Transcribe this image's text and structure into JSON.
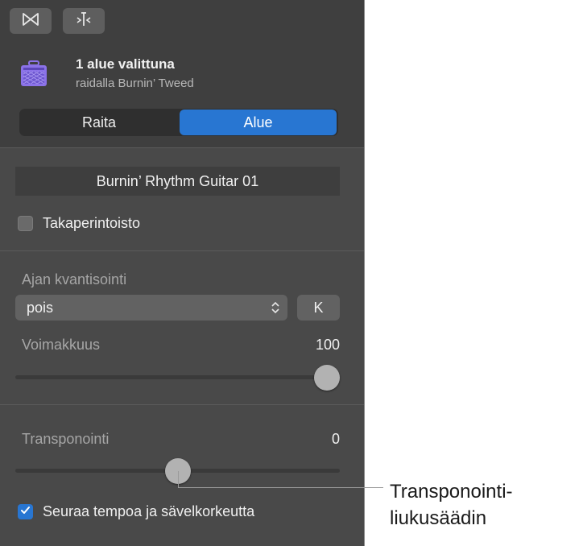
{
  "toolbar": {
    "icons": [
      "bowtie-icon",
      "split-icon"
    ]
  },
  "header": {
    "title": "1 alue valittuna",
    "subtitle": "raidalla Burnin’ Tweed",
    "icon": "guitar-amp-icon",
    "amp_color": "#8b72e8"
  },
  "segmented": {
    "raita": "Raita",
    "alue": "Alue",
    "selected": "Alue"
  },
  "region": {
    "name": "Burnin’ Rhythm Guitar 01",
    "loop_label": "Takaperintoisto",
    "loop_checked": false
  },
  "quantize": {
    "label": "Ajan kvantisointi",
    "value": "pois",
    "button": "K"
  },
  "velocity": {
    "label": "Voimakkuus",
    "value": "100",
    "level": 1.0
  },
  "transpose": {
    "label": "Transponointi",
    "value": "0",
    "level": 0.5
  },
  "follow": {
    "label": "Seuraa tempoa ja sävelkorkeutta",
    "checked": true
  },
  "callout": {
    "line1": "Transponointi-",
    "line2": "liukusäädin"
  },
  "colors": {
    "accent": "#2876d2",
    "panel": "#494949",
    "header": "#3f3f3f"
  }
}
